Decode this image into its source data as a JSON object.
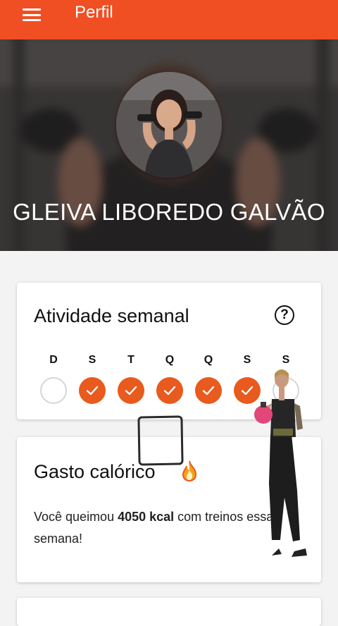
{
  "appbar": {
    "title": "Perfil",
    "menu_icon": "menu-icon"
  },
  "profile": {
    "name": "GLEIVA LIBOREDO GALVÃO"
  },
  "weekly_activity": {
    "title": "Atividade semanal",
    "help_icon": "help-circle-icon",
    "days": [
      {
        "label": "D",
        "done": false
      },
      {
        "label": "S",
        "done": true
      },
      {
        "label": "T",
        "done": true
      },
      {
        "label": "Q",
        "done": true
      },
      {
        "label": "Q",
        "done": true
      },
      {
        "label": "S",
        "done": true
      },
      {
        "label": "S",
        "done": false
      }
    ]
  },
  "calories": {
    "title": "Gasto calórico",
    "icon": "flame-icon",
    "text_before": "Você queimou ",
    "value": "4050 kcal",
    "text_after": " com treinos essa semana!"
  },
  "colors": {
    "brand": "#f04e23",
    "check": "#e85a1d"
  }
}
